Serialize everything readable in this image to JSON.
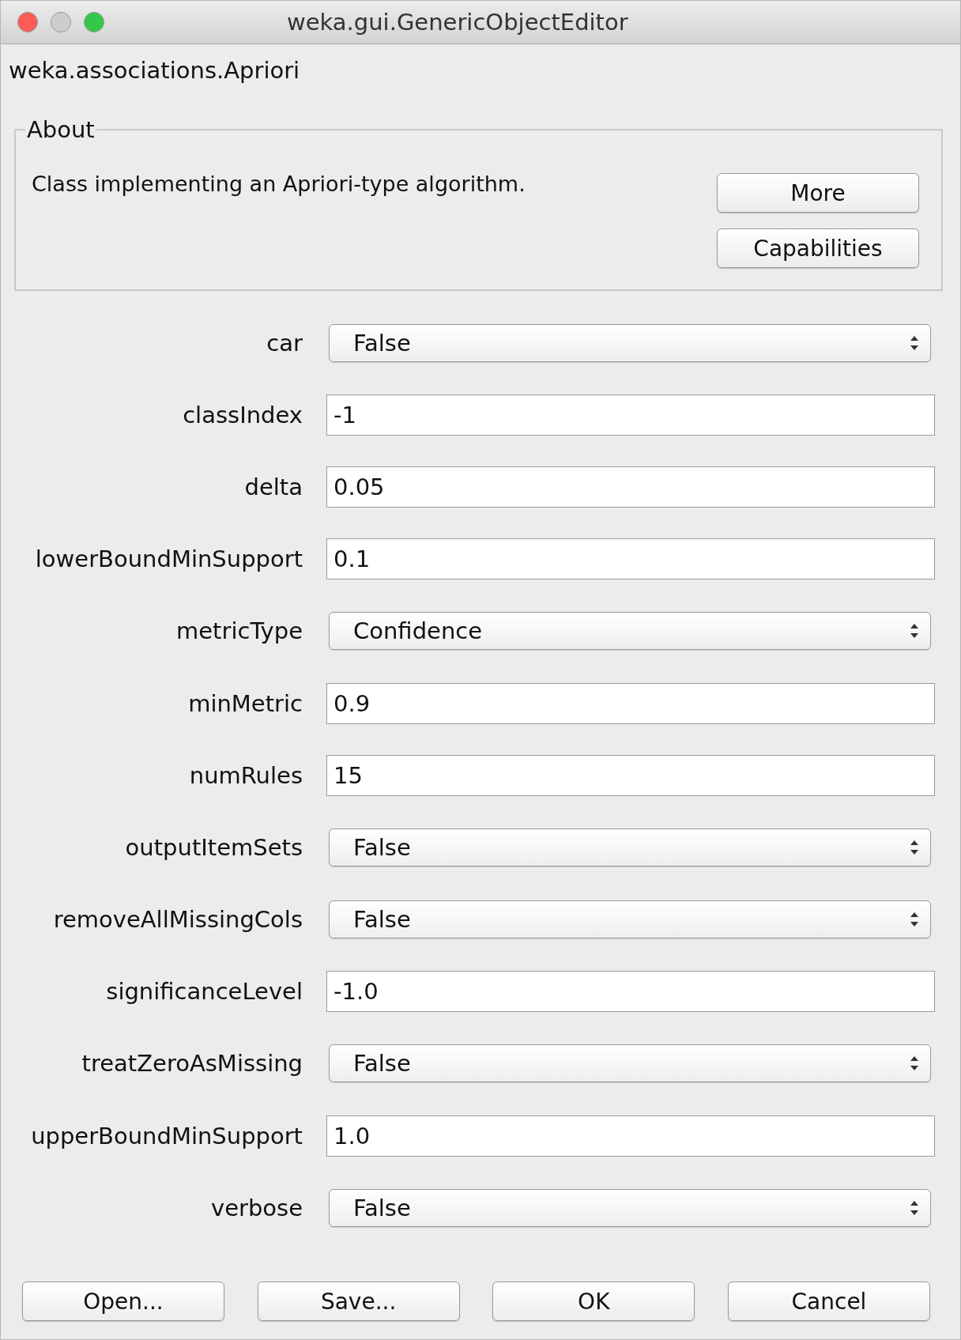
{
  "window": {
    "title": "weka.gui.GenericObjectEditor"
  },
  "class_name": "weka.associations.Apriori",
  "about": {
    "title": "About",
    "description": "Class implementing an Apriori-type algorithm.",
    "buttons": [
      "More",
      "Capabilities"
    ]
  },
  "properties": [
    {
      "label": "car",
      "kind": "select",
      "value": "False"
    },
    {
      "label": "classIndex",
      "kind": "text",
      "value": "-1"
    },
    {
      "label": "delta",
      "kind": "text",
      "value": "0.05"
    },
    {
      "label": "lowerBoundMinSupport",
      "kind": "text",
      "value": "0.1"
    },
    {
      "label": "metricType",
      "kind": "select",
      "value": "Confidence"
    },
    {
      "label": "minMetric",
      "kind": "text",
      "value": "0.9"
    },
    {
      "label": "numRules",
      "kind": "text",
      "value": "15"
    },
    {
      "label": "outputItemSets",
      "kind": "select",
      "value": "False"
    },
    {
      "label": "removeAllMissingCols",
      "kind": "select",
      "value": "False"
    },
    {
      "label": "significanceLevel",
      "kind": "text",
      "value": "-1.0"
    },
    {
      "label": "treatZeroAsMissing",
      "kind": "select",
      "value": "False"
    },
    {
      "label": "upperBoundMinSupport",
      "kind": "text",
      "value": "1.0"
    },
    {
      "label": "verbose",
      "kind": "select",
      "value": "False"
    }
  ],
  "buttons": [
    "Open...",
    "Save...",
    "OK",
    "Cancel"
  ]
}
